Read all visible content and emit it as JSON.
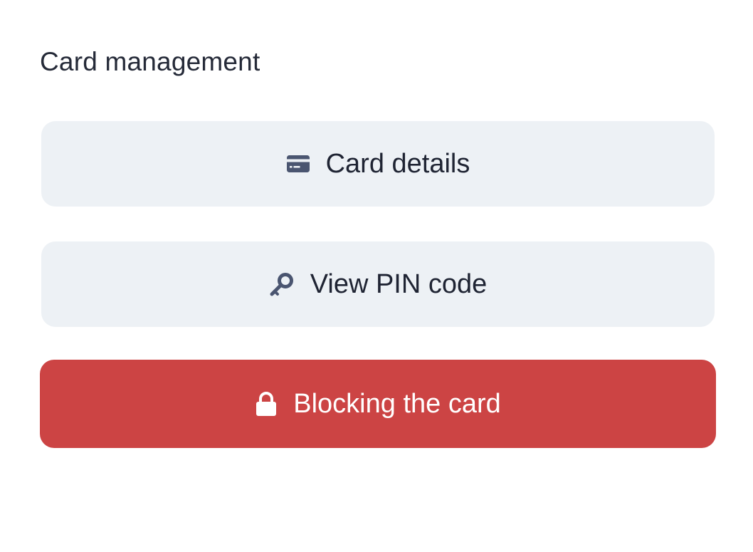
{
  "section": {
    "title": "Card management"
  },
  "actions": [
    {
      "label": "Card details",
      "icon": "credit-card-icon",
      "variant": "light"
    },
    {
      "label": "View PIN code",
      "icon": "key-icon",
      "variant": "light"
    },
    {
      "label": "Blocking the card",
      "icon": "lock-icon",
      "variant": "danger"
    }
  ],
  "colors": {
    "light_button_bg": "#edf1f5",
    "danger_button_bg": "#cc4444",
    "icon_color": "#4a5570",
    "text_color": "#1f2433"
  }
}
